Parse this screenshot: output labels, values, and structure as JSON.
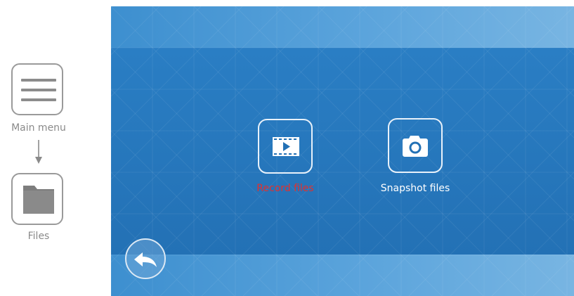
{
  "guide": {
    "main_menu_label": "Main menu",
    "files_label": "Files",
    "main_menu_icon": "hamburger-menu-icon",
    "files_icon": "folder-icon"
  },
  "screen": {
    "record_files_label": "Record files",
    "snapshot_files_label": "Snapshot files",
    "record_icon": "video-film-play-icon",
    "snapshot_icon": "camera-icon",
    "back_icon": "back-arrow-icon"
  },
  "colors": {
    "screen_blue": "#2371b5",
    "band_blue": "#5ba4dc",
    "selected_label": "#e2302d",
    "normal_label": "#ffffff",
    "guide_gray": "#8a8a8a"
  }
}
